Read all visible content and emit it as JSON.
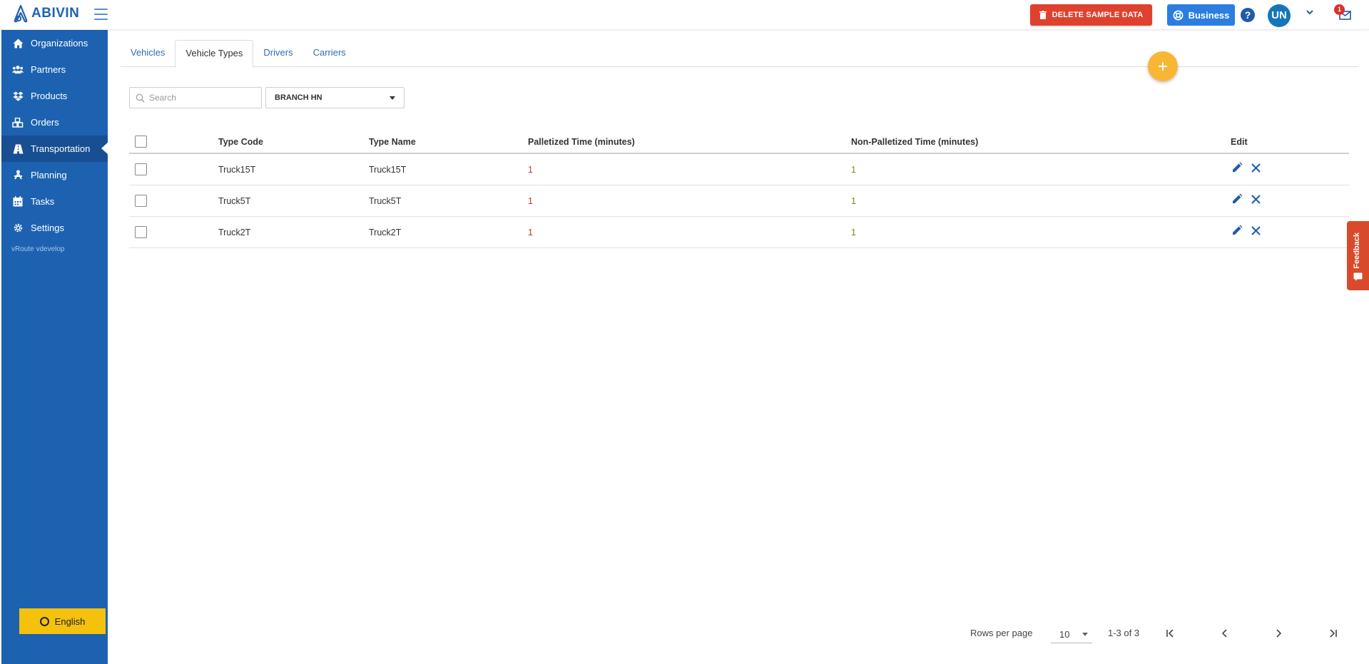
{
  "brand": {
    "name": "ABIVIN"
  },
  "topbar": {
    "delete_label": "DELETE SAMPLE DATA",
    "business_label": "Business",
    "help": "?",
    "avatar": "UN",
    "notifications": "1"
  },
  "sidebar": {
    "items": [
      {
        "label": "Organizations",
        "icon": "home-icon"
      },
      {
        "label": "Partners",
        "icon": "users-icon"
      },
      {
        "label": "Products",
        "icon": "dropbox-icon"
      },
      {
        "label": "Orders",
        "icon": "cubes-icon"
      },
      {
        "label": "Transportation",
        "icon": "road-icon",
        "active": true
      },
      {
        "label": "Planning",
        "icon": "planning-icon"
      },
      {
        "label": "Tasks",
        "icon": "calendar-icon"
      },
      {
        "label": "Settings",
        "icon": "gear-icon"
      }
    ],
    "version": "vRoute vdevelop",
    "language": "English"
  },
  "tabs": [
    {
      "label": "Vehicles"
    },
    {
      "label": "Vehicle Types",
      "active": true
    },
    {
      "label": "Drivers"
    },
    {
      "label": "Carriers"
    }
  ],
  "filters": {
    "search_placeholder": "Search",
    "branch": "BRANCH HN"
  },
  "table": {
    "headers": {
      "type_code": "Type Code",
      "type_name": "Type Name",
      "palletized": "Palletized Time (minutes)",
      "non_palletized": "Non-Palletized Time (minutes)",
      "edit": "Edit"
    },
    "rows": [
      {
        "type_code": "Truck15T",
        "type_name": "Truck15T",
        "palletized": "1",
        "non_palletized": "1"
      },
      {
        "type_code": "Truck5T",
        "type_name": "Truck5T",
        "palletized": "1",
        "non_palletized": "1"
      },
      {
        "type_code": "Truck2T",
        "type_name": "Truck2T",
        "palletized": "1",
        "non_palletized": "1"
      }
    ]
  },
  "pagination": {
    "rows_per_page_label": "Rows per page",
    "rows_per_page": "10",
    "range": "1-3 of 3"
  },
  "feedback": {
    "label": "Feedback"
  },
  "colors": {
    "sidebar": "#1d62b1",
    "delete": "#e0412e",
    "business": "#2b7ee0",
    "fab": "#f8b634",
    "language": "#f4c10d",
    "feedback": "#d94a2b"
  }
}
